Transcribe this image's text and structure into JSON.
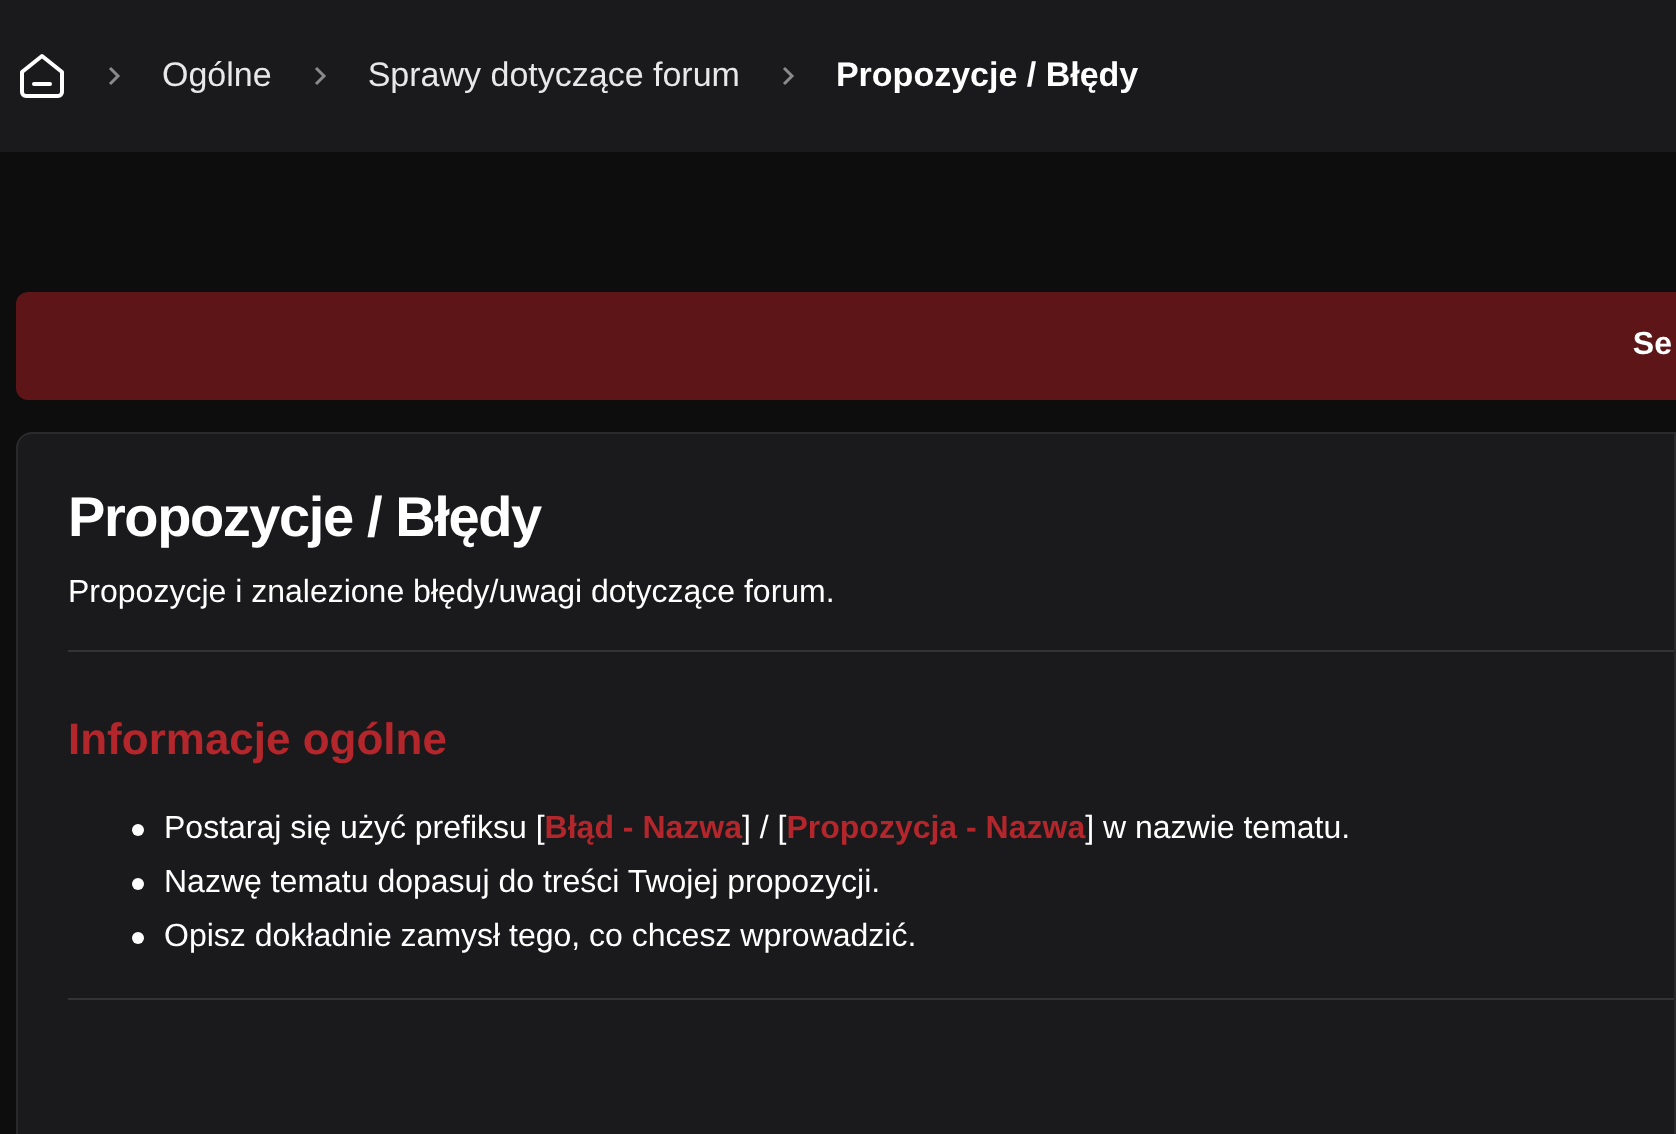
{
  "breadcrumbs": [
    {
      "label": "Ogólne",
      "current": false
    },
    {
      "label": "Sprawy dotyczące forum",
      "current": false
    },
    {
      "label": "Propozycje / Błędy",
      "current": true
    }
  ],
  "banner": {
    "text": "Se"
  },
  "forum": {
    "title": "Propozycje / Błędy",
    "description": "Propozycje i znalezione błędy/uwagi dotyczące forum.",
    "section_heading": "Informacje ogólne",
    "items": [
      "Postaraj się użyć prefiksu [**Błąd - Nazwa**] / [**Propozycja - Nazwa**] w nazwie tematu.",
      "Nazwę tematu dopasuj do treści Twojej propozycji.",
      "Opisz dokładnie zamysł tego, co chcesz wprowadzić."
    ]
  }
}
